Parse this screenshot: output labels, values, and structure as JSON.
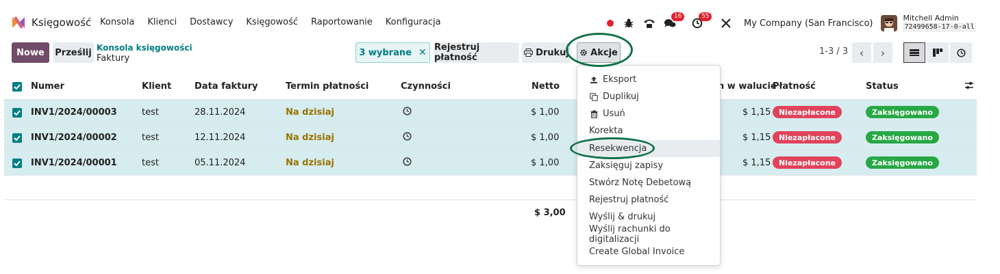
{
  "navbar": {
    "app_name": "Księgowość",
    "menu": [
      "Konsola",
      "Klienci",
      "Dostawcy",
      "Księgowość",
      "Raportowanie",
      "Konfiguracja"
    ],
    "chat_badge": "16",
    "activity_badge": "55",
    "company": "My Company (San Francisco)",
    "user_name": "Mitchell Admin",
    "user_db": "72499658-17-0-all"
  },
  "control": {
    "new_label": "Nowe",
    "upload_label": "Prześlij",
    "breadcrumb_parent": "Konsola księgowości",
    "breadcrumb_current": "Faktury",
    "selected_label": "3 wybrane",
    "register_payment_label": "Rejestruj płatność",
    "print_label": "Drukuj",
    "actions_label": "Akcje",
    "pager": "1-3 / 3"
  },
  "table": {
    "columns": {
      "number": "Numer",
      "client": "Klient",
      "invoice_date": "Data faktury",
      "due_date": "Termin płatności",
      "activities": "Czynności",
      "net": "Netto",
      "total_currency": "n w walucie",
      "payment": "Płatność",
      "status": "Status"
    },
    "rows": [
      {
        "number": "INV1/2024/00003",
        "client": "test",
        "date": "28.11.2024",
        "due": "Na dzisiaj",
        "net": "$ 1,00",
        "total": "$ 1,15",
        "payment": "Niezapłacone",
        "status": "Zaksięgowano"
      },
      {
        "number": "INV1/2024/00002",
        "client": "test",
        "date": "12.11.2024",
        "due": "Na dzisiaj",
        "net": "$ 1,00",
        "total": "$ 1,15",
        "payment": "Niezapłacone",
        "status": "Zaksięgowano"
      },
      {
        "number": "INV1/2024/00001",
        "client": "test",
        "date": "05.11.2024",
        "due": "Na dzisiaj",
        "net": "$ 1,00",
        "total": "$ 1,15",
        "payment": "Niezapłacone",
        "status": "Zaksięgowano"
      }
    ],
    "net_total": "$ 3,00"
  },
  "actions_menu": {
    "items": [
      {
        "label": "Eksport",
        "icon": "upload-icon"
      },
      {
        "label": "Duplikuj",
        "icon": "copy-icon"
      },
      {
        "label": "Usuń",
        "icon": "trash-icon"
      },
      {
        "label": "Korekta",
        "icon": ""
      },
      {
        "label": "Resekwencja",
        "icon": ""
      },
      {
        "label": "Zaksięguj zapisy",
        "icon": ""
      },
      {
        "label": "Stwórz Notę Debetową",
        "icon": ""
      },
      {
        "label": "Rejestruj płatność",
        "icon": ""
      },
      {
        "label": "Wyślij & drukuj",
        "icon": ""
      },
      {
        "label": "Wyślij rachunki do digitalizacji",
        "icon": ""
      },
      {
        "label": "Create Global Invoice",
        "icon": ""
      }
    ]
  },
  "colors": {
    "primary": "#714b67",
    "teal": "#017e84",
    "selected_row": "#d6ecef",
    "due_text": "#9a7400",
    "unpaid_tag": "#e0435b",
    "posted_tag": "#28a745",
    "annotation_ring": "#0f7048"
  }
}
